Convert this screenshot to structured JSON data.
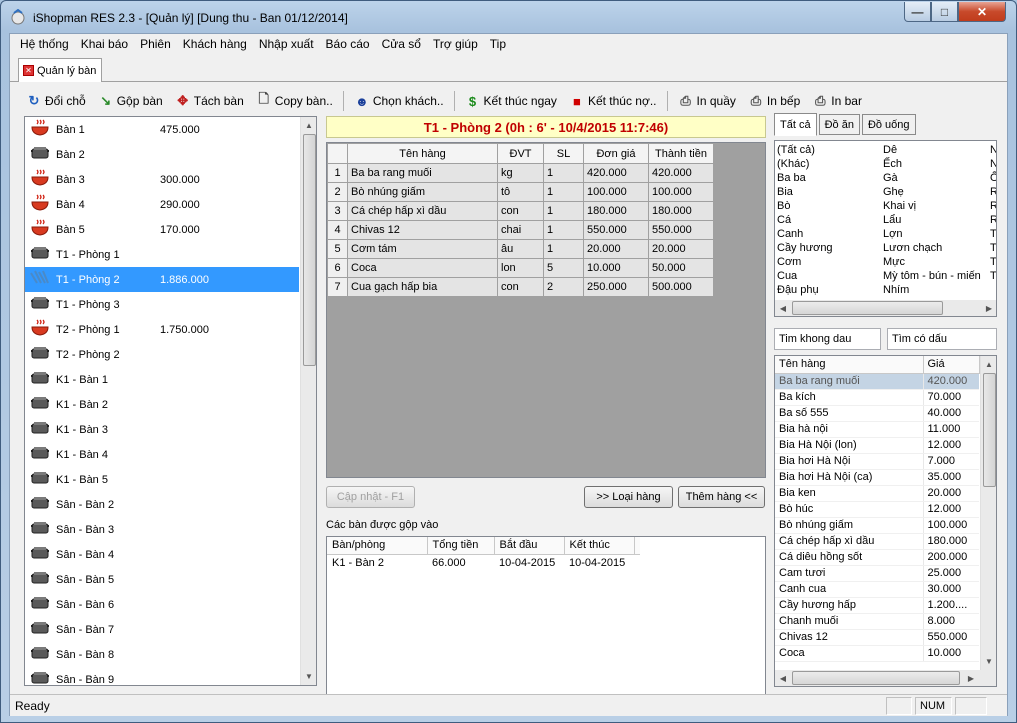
{
  "window": {
    "title": "iShopman RES 2.3 - [Quản lý] [Dung thu - Ban 01/12/2014]"
  },
  "menu": [
    "Hệ thống",
    "Khai báo",
    "Phiên",
    "Khách hàng",
    "Nhập xuất",
    "Báo cáo",
    "Cửa sổ",
    "Trợ giúp",
    "Tip"
  ],
  "doc_tab": "Quản lý bàn",
  "toolbar": [
    {
      "label": "Đổi chỗ",
      "icon": "swap-icon"
    },
    {
      "label": "Gộp bàn",
      "icon": "merge-icon"
    },
    {
      "label": "Tách bàn",
      "icon": "split-icon"
    },
    {
      "label": "Copy bàn..",
      "icon": "copy-icon"
    },
    {
      "label": "Chọn khách..",
      "icon": "customer-icon"
    },
    {
      "label": "Kết thúc ngay",
      "icon": "money-icon"
    },
    {
      "label": "Kết thúc nợ..",
      "icon": "debt-icon"
    },
    {
      "label": "In quầy",
      "icon": "printer-icon"
    },
    {
      "label": "In bếp",
      "icon": "printer-icon"
    },
    {
      "label": "In bar",
      "icon": "printer-icon"
    }
  ],
  "tables": [
    {
      "name": "Bàn 1",
      "amount": "475.000",
      "state": "busy"
    },
    {
      "name": "Bàn 2",
      "amount": "",
      "state": "empty"
    },
    {
      "name": "Bàn 3",
      "amount": "300.000",
      "state": "busy"
    },
    {
      "name": "Bàn 4",
      "amount": "290.000",
      "state": "busy"
    },
    {
      "name": "Bàn 5",
      "amount": "170.000",
      "state": "busy"
    },
    {
      "name": "T1 - Phòng 1",
      "amount": "",
      "state": "empty"
    },
    {
      "name": "T1 - Phòng 2",
      "amount": "1.886.000",
      "state": "merged",
      "selected": true
    },
    {
      "name": "T1 - Phòng 3",
      "amount": "",
      "state": "empty"
    },
    {
      "name": "T2 - Phòng 1",
      "amount": "1.750.000",
      "state": "busy"
    },
    {
      "name": "T2 - Phòng 2",
      "amount": "",
      "state": "empty"
    },
    {
      "name": "K1 - Bàn 1",
      "amount": "",
      "state": "empty"
    },
    {
      "name": "K1 - Bàn 2",
      "amount": "",
      "state": "empty"
    },
    {
      "name": "K1 - Bàn 3",
      "amount": "",
      "state": "empty"
    },
    {
      "name": "K1 - Bàn 4",
      "amount": "",
      "state": "empty"
    },
    {
      "name": "K1 - Bàn 5",
      "amount": "",
      "state": "empty"
    },
    {
      "name": "Sân - Bàn 2",
      "amount": "",
      "state": "empty"
    },
    {
      "name": "Sân - Bàn 3",
      "amount": "",
      "state": "empty"
    },
    {
      "name": "Sân - Bàn 4",
      "amount": "",
      "state": "empty"
    },
    {
      "name": "Sân - Bàn 5",
      "amount": "",
      "state": "empty"
    },
    {
      "name": "Sân - Bàn 6",
      "amount": "",
      "state": "empty"
    },
    {
      "name": "Sân - Bàn 7",
      "amount": "",
      "state": "empty"
    },
    {
      "name": "Sân - Bàn 8",
      "amount": "",
      "state": "empty"
    },
    {
      "name": "Sân - Bàn 9",
      "amount": "",
      "state": "empty"
    }
  ],
  "current": {
    "header": "T1 - Phòng 2 (0h : 6' - 10/4/2015 11:7:46)"
  },
  "order": {
    "columns": [
      "Tên hàng",
      "ĐVT",
      "SL",
      "Đơn giá",
      "Thành tiền"
    ],
    "rows": [
      [
        "1",
        "Ba ba rang muối",
        "kg",
        "1",
        "420.000",
        "420.000"
      ],
      [
        "2",
        "Bò nhúng giấm",
        "tô",
        "1",
        "100.000",
        "100.000"
      ],
      [
        "3",
        "Cá chép hấp xì dầu",
        "con",
        "1",
        "180.000",
        "180.000"
      ],
      [
        "4",
        "Chivas 12",
        "chai",
        "1",
        "550.000",
        "550.000"
      ],
      [
        "5",
        "Cơm tám",
        "âu",
        "1",
        "20.000",
        "20.000"
      ],
      [
        "6",
        "Coca",
        "lon",
        "5",
        "10.000",
        "50.000"
      ],
      [
        "7",
        "Cua gạch hấp bia",
        "con",
        "2",
        "250.000",
        "500.000"
      ]
    ]
  },
  "buttons": {
    "update": "Cập nhật - F1",
    "remove": ">> Loại hàng",
    "add": "Thêm hàng <<"
  },
  "merged": {
    "label": "Các bàn được gộp vào",
    "columns": [
      "Bàn/phòng",
      "Tổng tiền",
      "Bắt đầu",
      "Kết thúc"
    ],
    "rows": [
      [
        "K1 - Bàn 2",
        "66.000",
        "10-04-2015",
        "10-04-2015"
      ]
    ]
  },
  "category_tabs": [
    "Tất cả",
    "Đồ ăn",
    "Đồ uống"
  ],
  "categories": {
    "col1": [
      "(Tất cả)",
      "(Khác)",
      "Ba ba",
      "Bia",
      "Bò",
      "Cá",
      "Canh",
      "Cầy hương",
      "Cơm",
      "Cua",
      "Đậu phụ"
    ],
    "col2": [
      "Dê",
      "Ếch",
      "Gà",
      "Ghẹ",
      "Khai vị",
      "Lẩu",
      "Lợn",
      "Lươn chạch",
      "Mực",
      "Mỳ tôm - bún - miến",
      "Nhím"
    ],
    "col3": [
      "N",
      "N",
      "Ố",
      "R",
      "R",
      "R",
      "T",
      "T",
      "T",
      "T",
      ""
    ]
  },
  "search": {
    "no_accent": "Tim khong dau",
    "accent": "Tìm có dấu"
  },
  "items": {
    "columns": [
      "Tên hàng",
      "Giá"
    ],
    "rows": [
      [
        "Ba ba rang muối",
        "420.000"
      ],
      [
        "Ba kích",
        "70.000"
      ],
      [
        "Ba số 555",
        "40.000"
      ],
      [
        "Bia hà nội",
        "11.000"
      ],
      [
        "Bia Hà Nội (lon)",
        "12.000"
      ],
      [
        "Bia hơi Hà Nội",
        "7.000"
      ],
      [
        "Bia hơi Hà Nội (ca)",
        "35.000"
      ],
      [
        "Bia ken",
        "20.000"
      ],
      [
        "Bò húc",
        "12.000"
      ],
      [
        "Bò nhúng giấm",
        "100.000"
      ],
      [
        "Cá chép hấp xì dầu",
        "180.000"
      ],
      [
        "Cá diêu hồng sốt",
        "200.000"
      ],
      [
        "Cam tươi",
        "25.000"
      ],
      [
        "Canh cua",
        "30.000"
      ],
      [
        "Cầy hương hấp",
        "1.200...."
      ],
      [
        "Chanh muối",
        "8.000"
      ],
      [
        "Chivas 12",
        "550.000"
      ],
      [
        "Coca",
        "10.000"
      ]
    ]
  },
  "status": {
    "text": "Ready",
    "num": "NUM"
  }
}
